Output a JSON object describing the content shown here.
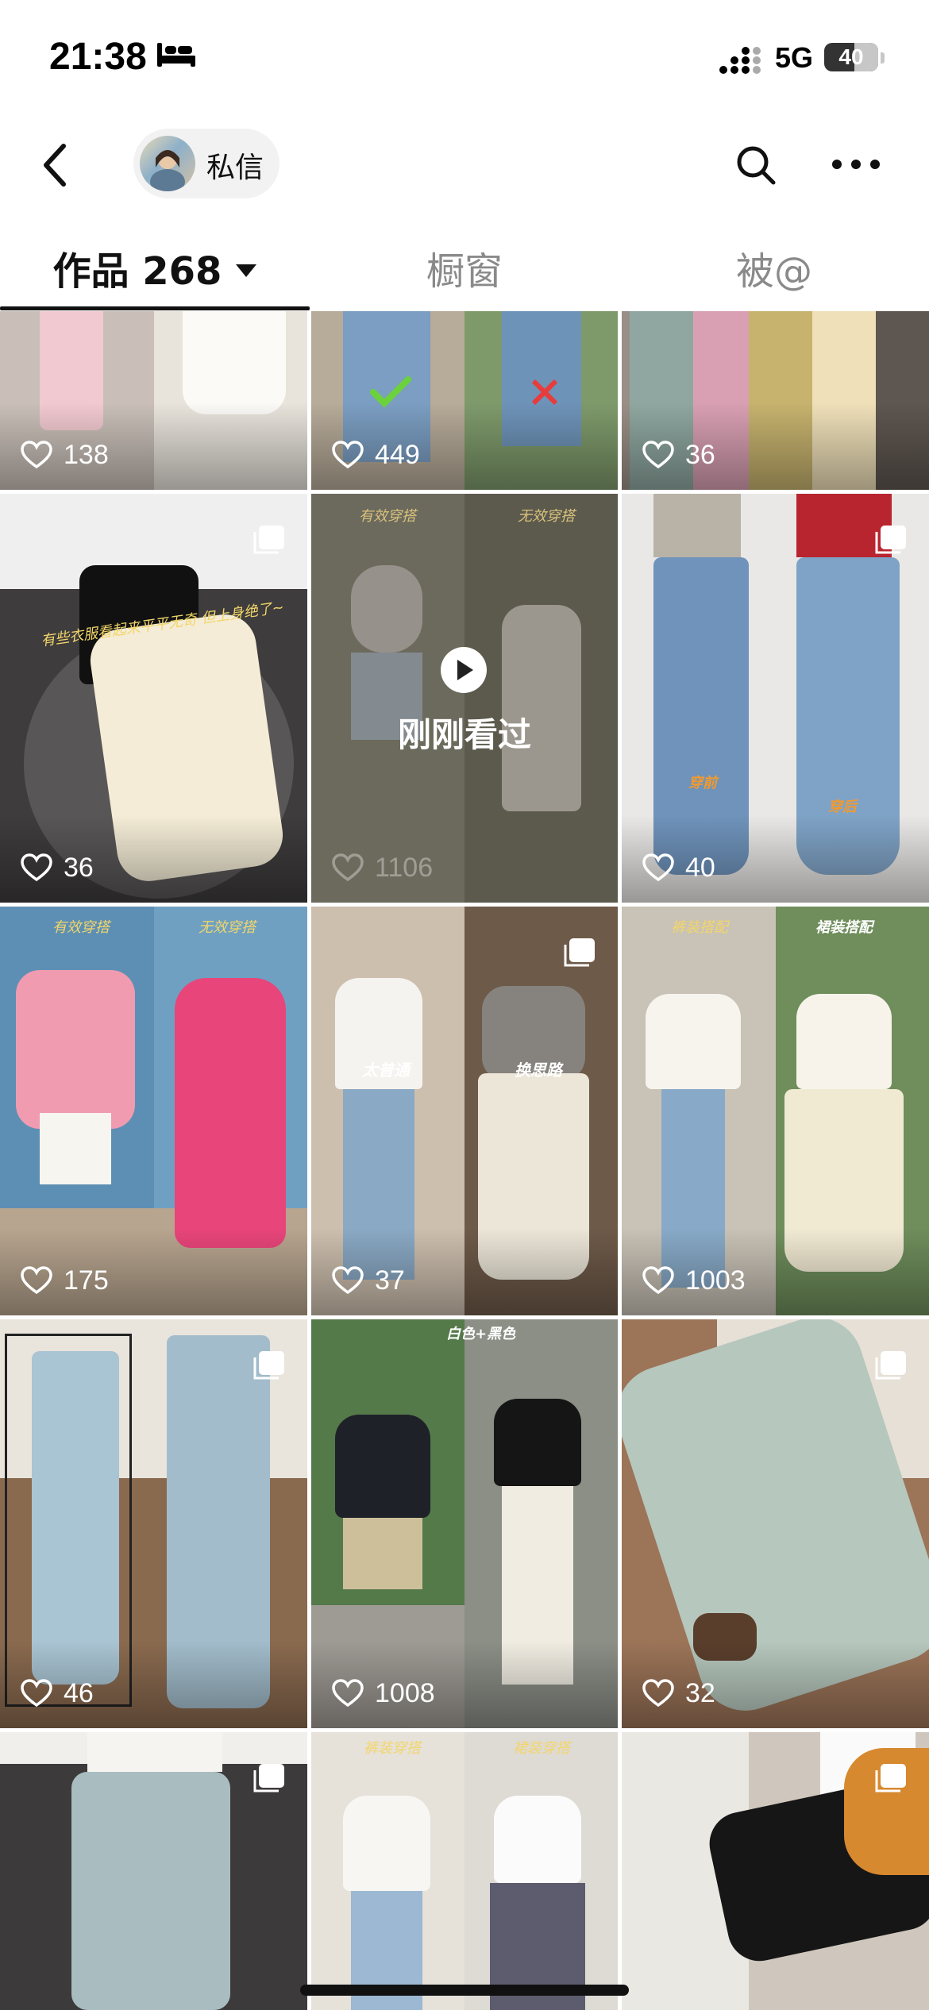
{
  "status": {
    "time": "21:38",
    "network": "5G",
    "battery": "40"
  },
  "nav": {
    "dm_label": "私信"
  },
  "tabs": [
    {
      "label": "作品 268"
    },
    {
      "label": "橱窗"
    },
    {
      "label": "被@"
    }
  ],
  "grid": {
    "items": [
      {
        "likes": "138"
      },
      {
        "likes": "449"
      },
      {
        "likes": "36"
      },
      {
        "likes": "36",
        "caption": "有些衣服看起来平平无奇 但上身绝了~"
      },
      {
        "likes": "1106",
        "seen_label": "刚刚看过",
        "captions": [
          "有效穿搭",
          "无效穿搭"
        ]
      },
      {
        "likes": "40",
        "captions": [
          "穿前",
          "穿后"
        ]
      },
      {
        "likes": "175",
        "captions": [
          "有效穿搭",
          "无效穿搭"
        ]
      },
      {
        "likes": "37",
        "captions": [
          "太普通",
          "换思路"
        ]
      },
      {
        "likes": "1003",
        "captions": [
          "裤装搭配",
          "裙装搭配"
        ]
      },
      {
        "likes": "46"
      },
      {
        "likes": "1008",
        "caption": "白色+黑色"
      },
      {
        "likes": "32"
      },
      {
        "captions": []
      },
      {
        "captions": [
          "裤装穿搭",
          "裙装穿搭"
        ]
      },
      {
        "captions": []
      }
    ]
  },
  "colors": {
    "accent": "#111111",
    "tab_inactive": "#8a8a8a",
    "like_text": "#ffffff"
  }
}
